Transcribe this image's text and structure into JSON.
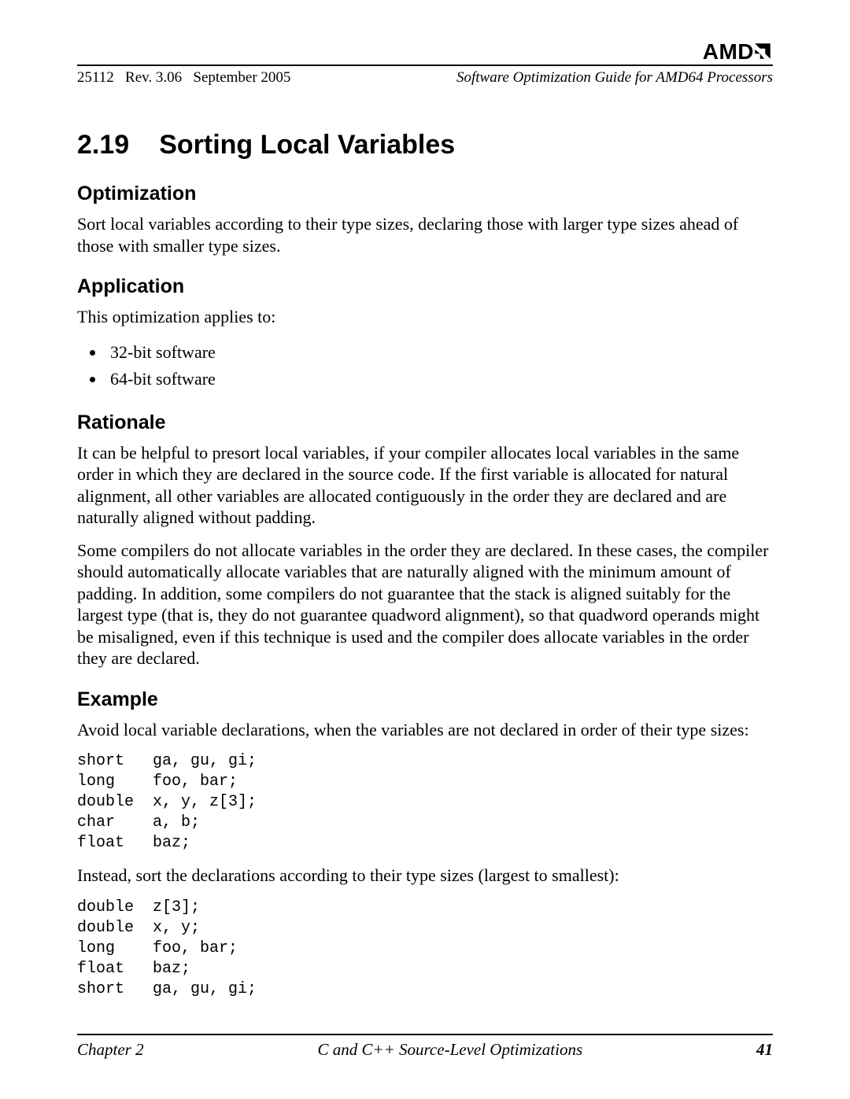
{
  "header": {
    "logo_text": "AMD",
    "docnum": "25112",
    "rev": "Rev. 3.06",
    "date": "September 2005",
    "doc_title": "Software Optimization Guide for AMD64 Processors"
  },
  "section": {
    "number": "2.19",
    "title": "Sorting Local Variables"
  },
  "optimization": {
    "heading": "Optimization",
    "text": "Sort local variables according to their type sizes, declaring those with larger type sizes ahead of those with smaller type sizes."
  },
  "application": {
    "heading": "Application",
    "intro": "This optimization applies to:",
    "items": [
      "32-bit software",
      "64-bit software"
    ]
  },
  "rationale": {
    "heading": "Rationale",
    "para1": "It can be helpful to presort local variables, if your compiler allocates local variables in the same order in which they are declared in the source code. If the first variable is allocated for natural alignment, all other variables are allocated contiguously in the order they are declared and are naturally aligned without padding.",
    "para2": "Some compilers do not allocate variables in the order they are declared. In these cases, the compiler should automatically allocate variables that are naturally aligned with the minimum amount of padding. In addition, some compilers do not guarantee that the stack is aligned suitably for the largest type (that is, they do not guarantee quadword alignment), so that quadword operands might be misaligned, even if this technique is used and the compiler does allocate variables in the order they are declared."
  },
  "example": {
    "heading": "Example",
    "intro1": "Avoid local variable declarations, when the variables are not declared in order of their type sizes:",
    "code1": "short   ga, gu, gi;\nlong    foo, bar;\ndouble  x, y, z[3];\nchar    a, b;\nfloat   baz;",
    "intro2": "Instead, sort the declarations according to their type sizes (largest to smallest):",
    "code2": "double  z[3];\ndouble  x, y;\nlong    foo, bar;\nfloat   baz;\nshort   ga, gu, gi;"
  },
  "footer": {
    "chapter": "Chapter 2",
    "title": "C and C++ Source-Level Optimizations",
    "page": "41"
  }
}
